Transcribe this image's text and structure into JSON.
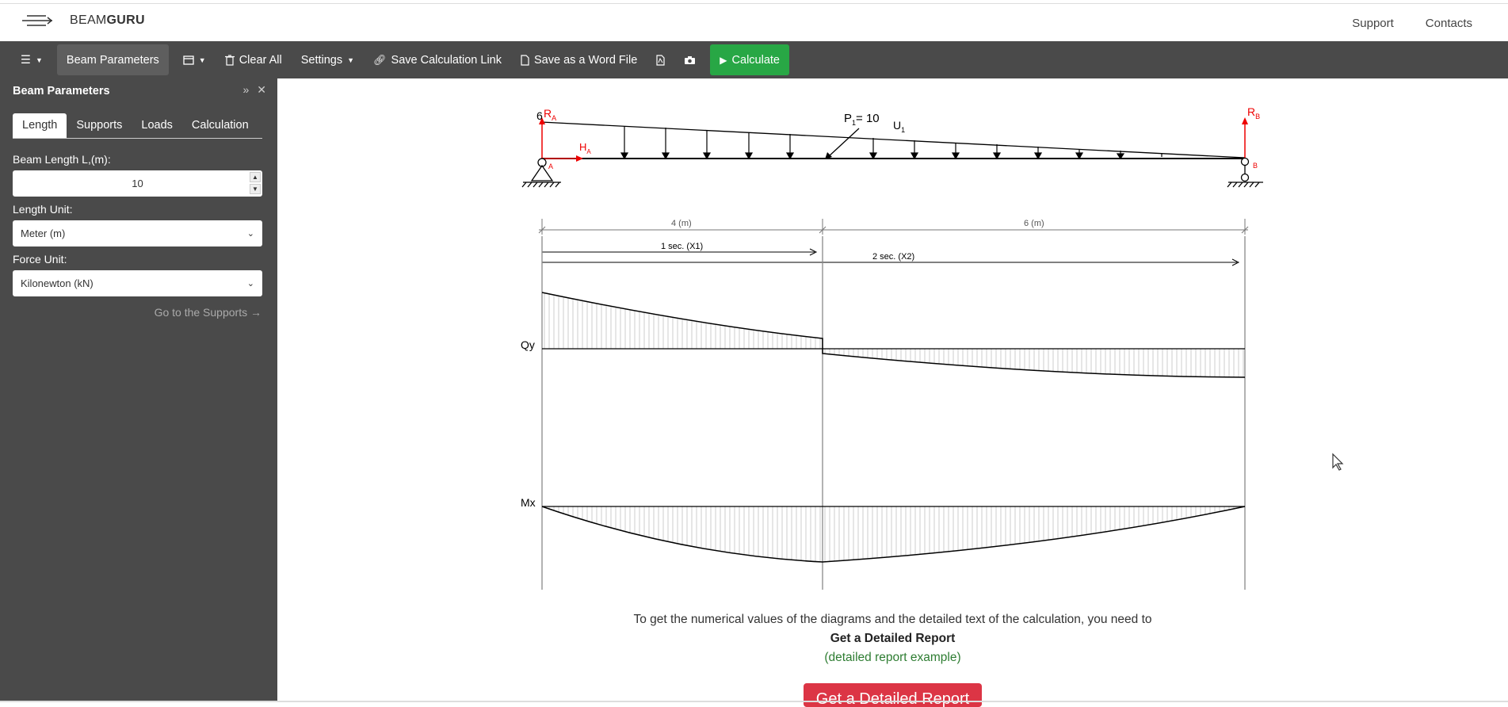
{
  "header": {
    "logo_light": "BEAM",
    "logo_bold": "GURU",
    "nav": [
      "Support",
      "Contacts"
    ]
  },
  "toolbar": {
    "menu_icon": "hamburger-icon",
    "beam_parameters": "Beam Parameters",
    "clear_all": "Clear All",
    "settings": "Settings",
    "save_link": "Save Calculation Link",
    "save_word": "Save as a Word File",
    "calculate": "Calculate",
    "calculate_color": "#28a745"
  },
  "sidebar": {
    "title": "Beam Parameters",
    "tabs": [
      "Length",
      "Supports",
      "Loads",
      "Calculation"
    ],
    "beam_length_label": "Beam Length L,(m):",
    "beam_length_value": "10",
    "length_unit_label": "Length Unit:",
    "length_unit_value": "Meter (m)",
    "force_unit_label": "Force Unit:",
    "force_unit_value": "Kilonewton (kN)",
    "goto": "Go to the Supports"
  },
  "diagram": {
    "load_start_value": "6",
    "ra": "R",
    "ra_sub": "A",
    "ha": "H",
    "ha_sub": "A",
    "rb": "R",
    "rb_sub": "B",
    "support_a": "A",
    "support_b": "B",
    "p1": "P",
    "p1_sub": "1",
    "p1_value": "= 10",
    "u1": "U",
    "u1_sub": "1",
    "dim_left": "4 (m)",
    "dim_right": "6 (m)",
    "sec1": "1 sec. (X1)",
    "sec2": "2 sec. (X2)",
    "qy": "Qy",
    "mx": "Mx"
  },
  "info": {
    "line1": "To get the numerical values of the diagrams and the detailed text of the calculation, you need to",
    "line2": "Get a Detailed Report",
    "line3": "(detailed report example)",
    "button": "Get a Detailed Report",
    "button_color": "#dc3545"
  }
}
